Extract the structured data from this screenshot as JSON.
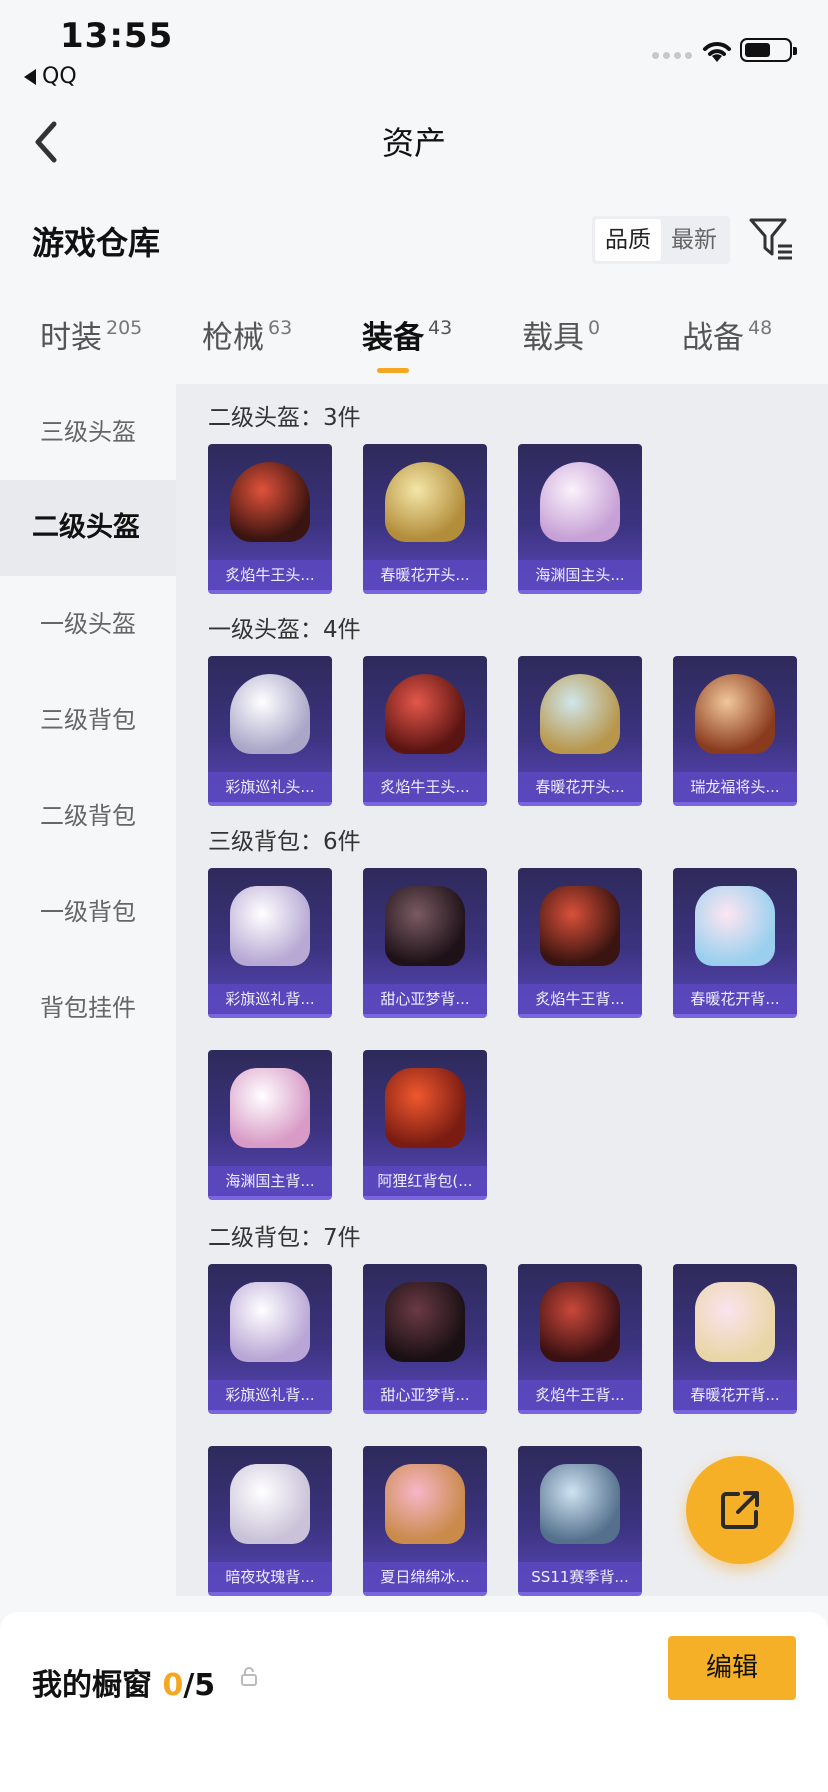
{
  "status_bar": {
    "time": "13:55",
    "back_app": "QQ"
  },
  "nav": {
    "title": "资产"
  },
  "header": {
    "title": "游戏仓库",
    "sort_options": [
      "品质",
      "最新"
    ],
    "sort_active": "品质"
  },
  "tabs": [
    {
      "label": "时装",
      "count": "205"
    },
    {
      "label": "枪械",
      "count": "63"
    },
    {
      "label": "装备",
      "count": "43",
      "active": true
    },
    {
      "label": "载具",
      "count": "0"
    },
    {
      "label": "战备",
      "count": "48"
    }
  ],
  "sidebar": {
    "items": [
      "三级头盔",
      "二级头盔",
      "一级头盔",
      "三级背包",
      "二级背包",
      "一级背包",
      "背包挂件"
    ],
    "active": "二级头盔"
  },
  "sections": [
    {
      "title": "二级头盔：3件",
      "items": [
        "炙焰牛王头...",
        "春暖花开头...",
        "海渊国主头..."
      ]
    },
    {
      "title": "一级头盔：4件",
      "items": [
        "彩旗巡礼头...",
        "炙焰牛王头...",
        "春暖花开头...",
        "瑞龙福将头..."
      ]
    },
    {
      "title": "三级背包：6件",
      "items": [
        "彩旗巡礼背...",
        "甜心亚梦背...",
        "炙焰牛王背...",
        "春暖花开背...",
        "海渊国主背...",
        "阿狸红背包(..."
      ]
    },
    {
      "title": "二级背包：7件",
      "items": [
        "彩旗巡礼背...",
        "甜心亚梦背...",
        "炙焰牛王背...",
        "春暖花开背...",
        "暗夜玫瑰背...",
        "夏日绵绵冰...",
        "SS11赛季背..."
      ]
    }
  ],
  "footer": {
    "label": "我的橱窗",
    "count_current": "0",
    "count_total": "/5",
    "edit_label": "编辑"
  },
  "colors": {
    "accent": "#f5a623",
    "card_bg": "#3c3380",
    "card_label_bg": "#5a48be"
  },
  "icons": [
    "back-chevron-icon",
    "filter-icon",
    "share-icon",
    "lock-icon",
    "wifi-icon",
    "battery-icon"
  ]
}
